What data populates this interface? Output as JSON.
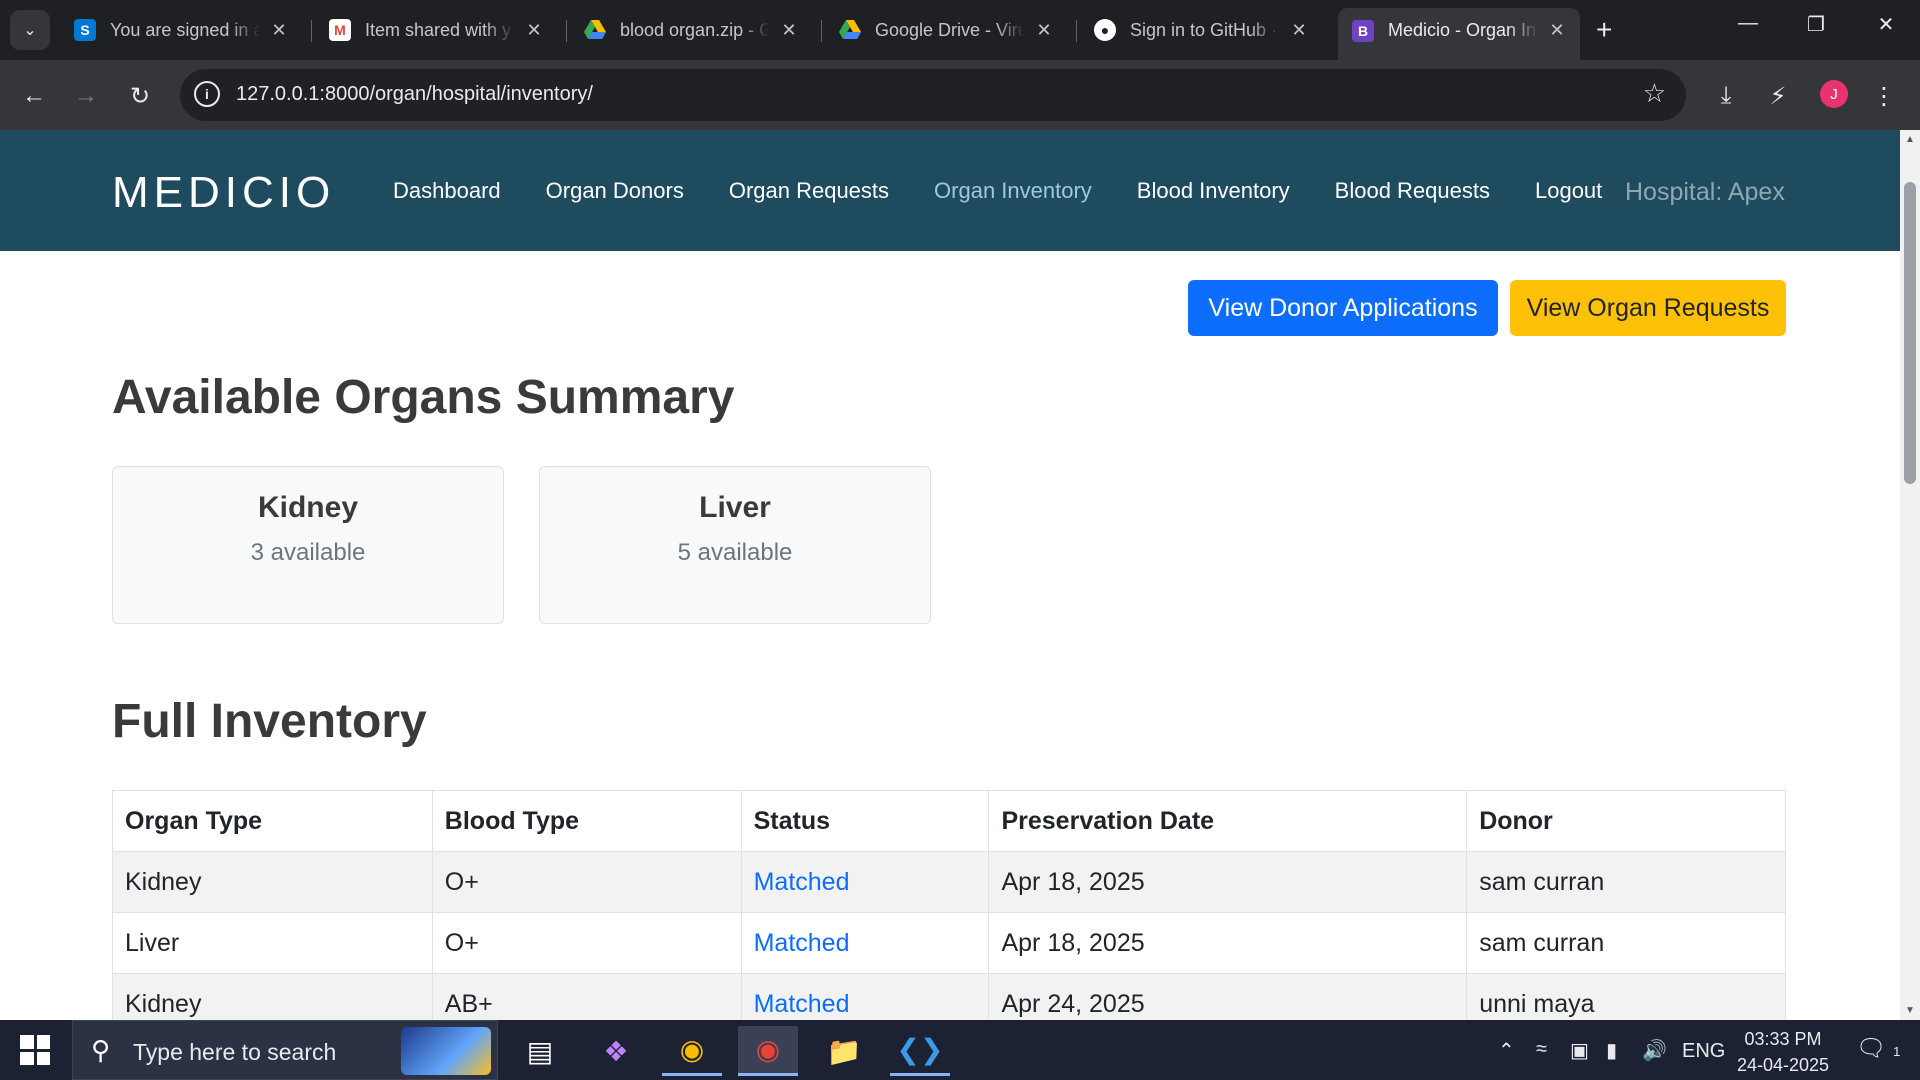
{
  "browser": {
    "tabs": [
      {
        "title": "You are signed in a",
        "favicon": "S",
        "favicon_color": "#0078d4",
        "active": false
      },
      {
        "title": "Item shared with y",
        "favicon": "M",
        "favicon_color": "#ea4335",
        "active": false
      },
      {
        "title": "blood organ.zip - G",
        "favicon": "drive",
        "favicon_color": "#34a853",
        "active": false
      },
      {
        "title": "Google Drive - Viru",
        "favicon": "drive",
        "favicon_color": "#34a853",
        "active": false
      },
      {
        "title": "Sign in to GitHub ·",
        "favicon": "github",
        "favicon_color": "#ffffff",
        "active": false
      },
      {
        "title": "Medicio - Organ In",
        "favicon": "B",
        "favicon_color": "#6f42c1",
        "active": true
      }
    ],
    "url": "127.0.0.1:8000/organ/hospital/inventory/",
    "profile_initial": "J"
  },
  "site": {
    "logo": "MEDICIO",
    "nav": [
      "Dashboard",
      "Organ Donors",
      "Organ Requests",
      "Organ Inventory",
      "Blood Inventory",
      "Blood Requests",
      "Logout"
    ],
    "current_nav": "Organ Inventory",
    "hospital_label": "Hospital: Apex"
  },
  "actions": {
    "view_donor_applications": "View Donor Applications",
    "view_organ_requests": "View Organ Requests"
  },
  "summary": {
    "title": "Available Organs Summary",
    "cards": [
      {
        "organ": "Kidney",
        "count_text": "3 available"
      },
      {
        "organ": "Liver",
        "count_text": "5 available"
      }
    ]
  },
  "inventory": {
    "title": "Full Inventory",
    "columns": [
      "Organ Type",
      "Blood Type",
      "Status",
      "Preservation Date",
      "Donor"
    ],
    "rows": [
      [
        "Kidney",
        "O+",
        "Matched",
        "Apr 18, 2025",
        "sam curran"
      ],
      [
        "Liver",
        "O+",
        "Matched",
        "Apr 18, 2025",
        "sam curran"
      ],
      [
        "Kidney",
        "AB+",
        "Matched",
        "Apr 24, 2025",
        "unni maya"
      ]
    ]
  },
  "taskbar": {
    "search_placeholder": "Type here to search",
    "language": "ENG",
    "time": "03:33 PM",
    "date": "24-04-2025",
    "notification_count": "1"
  }
}
